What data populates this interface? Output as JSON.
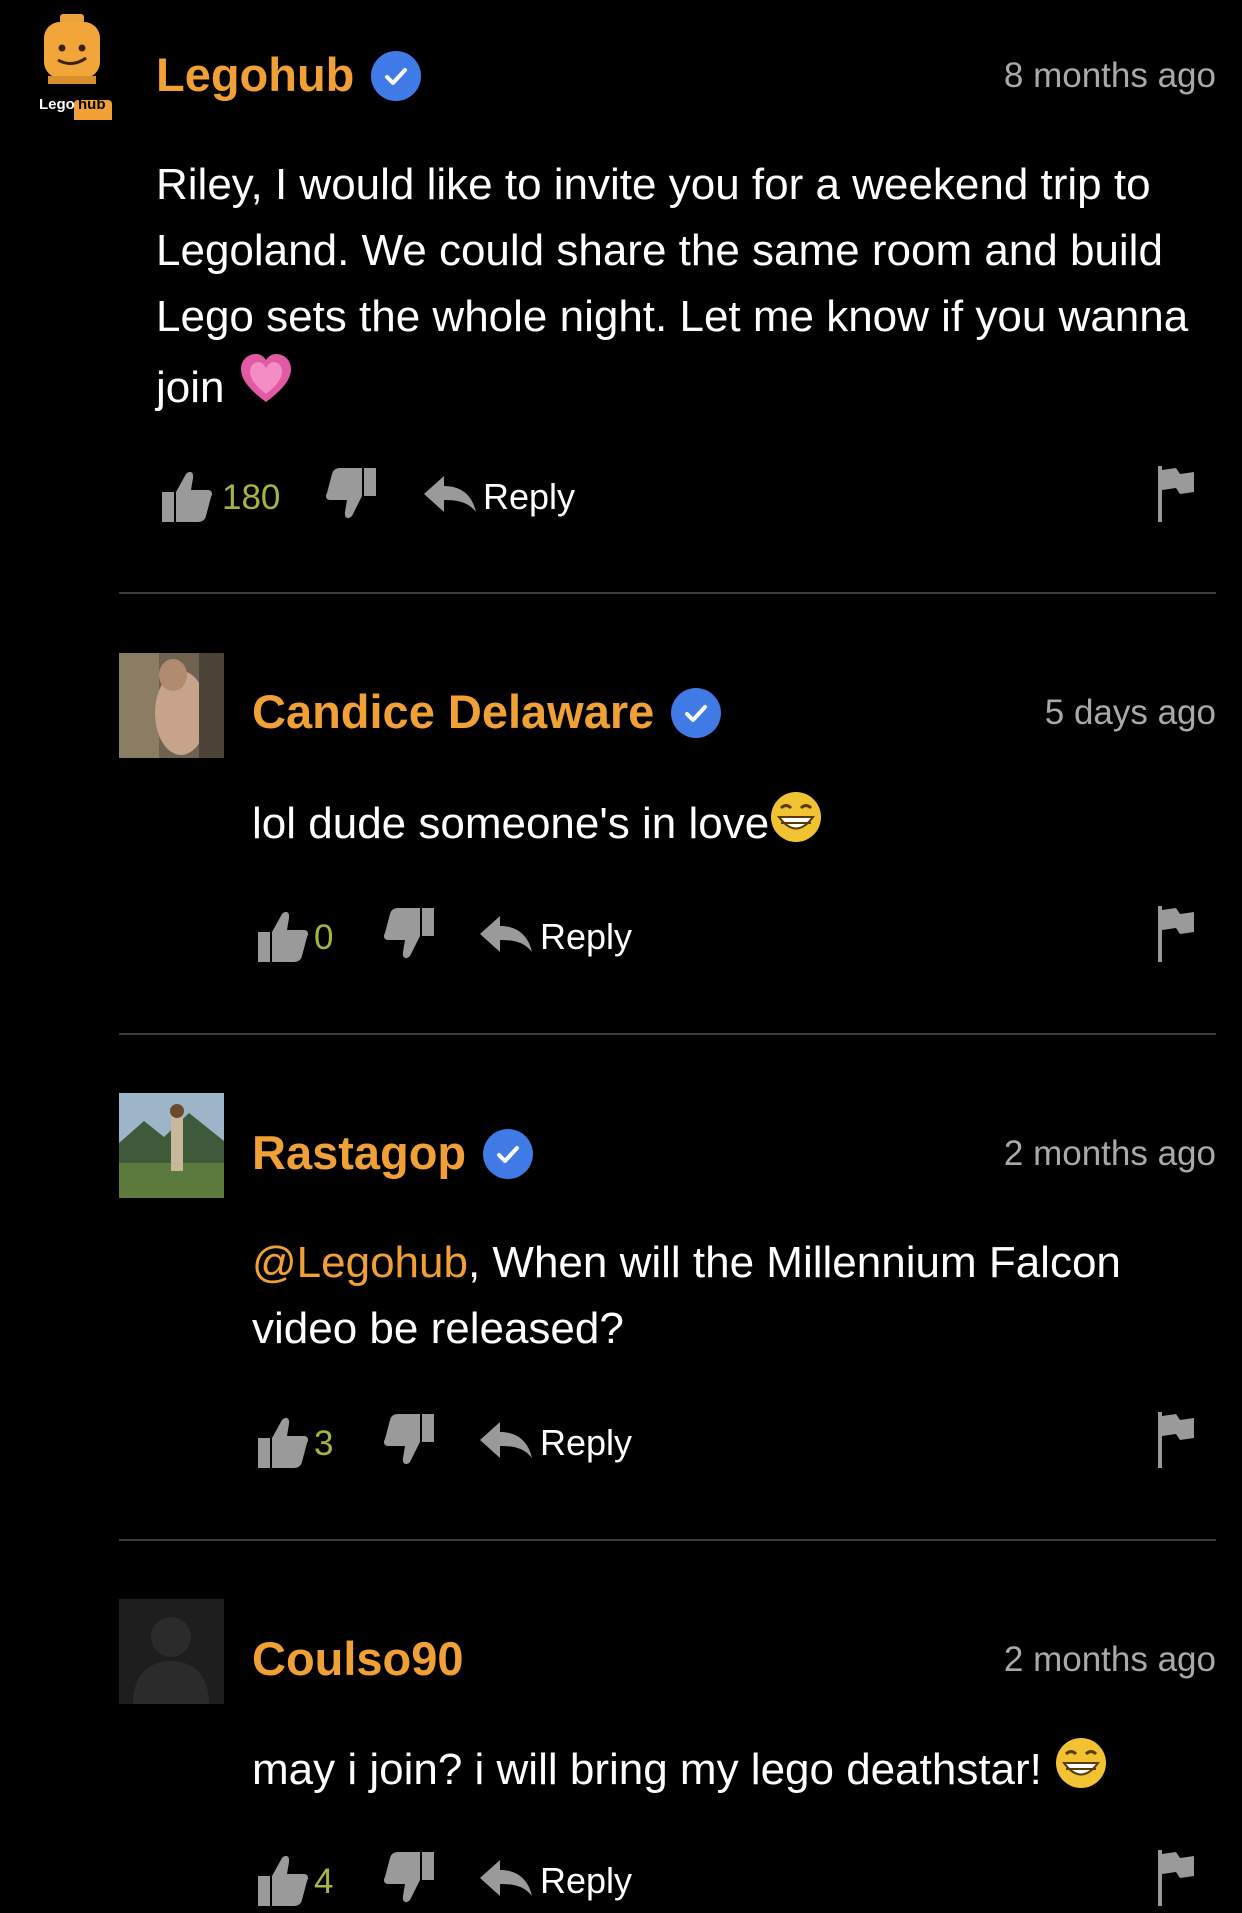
{
  "comments": [
    {
      "username": "Legohub",
      "verified": true,
      "timestamp": "8 months ago",
      "avatar_logo": {
        "part1": "Lego",
        "part2": "hub"
      },
      "text": "Riley, I would like to invite you for a weekend trip to Legoland. We could share the same room and build Lego sets the whole night. Let me know if you wanna join",
      "emoji": "heart",
      "likes": "180",
      "reply_label": "Reply"
    },
    {
      "username": "Candice Delaware",
      "verified": true,
      "timestamp": "5 days ago",
      "text": "lol dude someone's in love",
      "emoji": "grin",
      "likes": "0",
      "reply_label": "Reply"
    },
    {
      "username": "Rastagop",
      "verified": true,
      "timestamp": "2 months ago",
      "mention": "@Legohub",
      "text": ", When will the Millennium Falcon video be released?",
      "likes": "3",
      "reply_label": "Reply"
    },
    {
      "username": "Coulso90",
      "verified": false,
      "timestamp": "2 months ago",
      "text": "may i join? i will bring my lego deathstar!",
      "emoji": "grin",
      "likes": "4",
      "reply_label": "Reply"
    }
  ],
  "icons": {
    "like": "thumbs-up-icon",
    "dislike": "thumbs-down-icon",
    "reply": "reply-arrow-icon",
    "flag": "flag-icon",
    "verified": "verified-check-icon"
  },
  "colors": {
    "background": "#000000",
    "username": "#f0a035",
    "timestamp": "#a9a9a9",
    "like_count": "#a7b441",
    "verified": "#3f7ae6",
    "icon": "#9a9a9a",
    "divider": "#3a3a3a"
  }
}
